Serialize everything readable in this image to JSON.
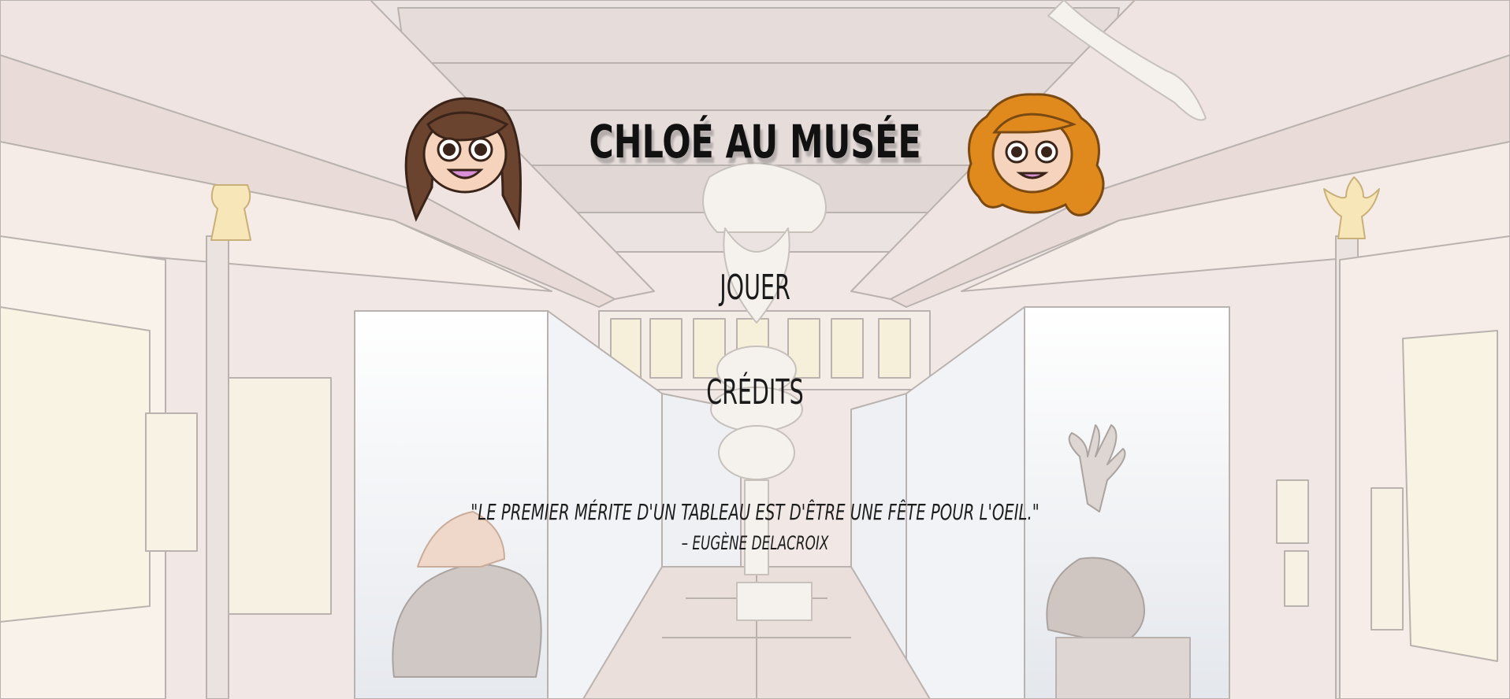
{
  "game": {
    "title": "CHLOÉ AU MUSÉE"
  },
  "menu": {
    "play_label": "JOUER",
    "credits_label": "CRÉDITS"
  },
  "quote": {
    "text": "\"LE PREMIER MÉRITE D'UN TABLEAU EST D'ÊTRE UNE FÊTE POUR L'OEIL.\"",
    "author": "– EUGÈNE DELACROIX"
  },
  "characters": [
    {
      "name": "brown-haired-girl-icon",
      "hair_color": "#6b4430"
    },
    {
      "name": "orange-haired-girl-icon",
      "hair_color": "#e08a1e"
    }
  ],
  "colors": {
    "background": "#f3ebe8",
    "text": "#111111"
  }
}
